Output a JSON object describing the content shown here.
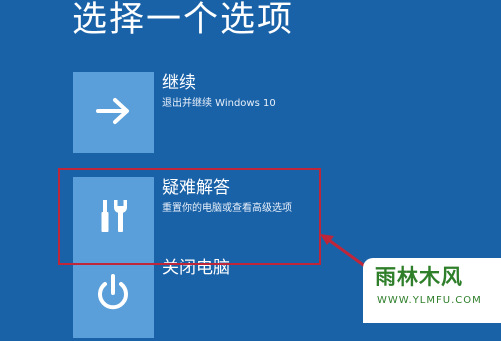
{
  "page": {
    "title": "选择一个选项"
  },
  "options": [
    {
      "id": "continue",
      "icon": "arrow-right-icon",
      "title": "继续",
      "description": "退出并继续 Windows 10"
    },
    {
      "id": "troubleshoot",
      "icon": "tools-icon",
      "title": "疑难解答",
      "description": "重置你的电脑或查看高级选项"
    },
    {
      "id": "poweroff",
      "icon": "power-icon",
      "title": "关闭电脑",
      "description": ""
    }
  ],
  "annotation": {
    "color": "#c0263a"
  },
  "watermark": {
    "main": "雨林木风",
    "url": "WWW.YLMFU.COM"
  },
  "colors": {
    "background": "#1a62a8",
    "tile": "#5a9fd9"
  }
}
